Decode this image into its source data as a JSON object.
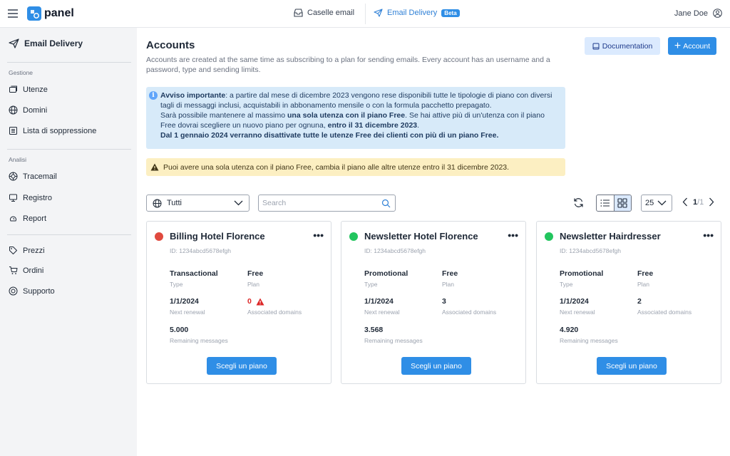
{
  "header": {
    "brand": "panel",
    "nav": [
      {
        "label": "Caselle email"
      },
      {
        "label": "Email Delivery",
        "badge": "Beta"
      }
    ],
    "user": "Jane Doe"
  },
  "sidebar": {
    "title": "Email Delivery",
    "sections": [
      {
        "heading": "Gestione",
        "items": [
          {
            "label": "Utenze",
            "icon": "users-icon"
          },
          {
            "label": "Domini",
            "icon": "globe-icon"
          },
          {
            "label": "Lista di soppressione",
            "icon": "list-icon"
          }
        ]
      },
      {
        "heading": "Analisi",
        "items": [
          {
            "label": "Tracemail",
            "icon": "trace-icon"
          },
          {
            "label": "Registro",
            "icon": "log-icon"
          },
          {
            "label": "Report",
            "icon": "report-icon"
          }
        ]
      },
      {
        "heading": "",
        "items": [
          {
            "label": "Prezzi",
            "icon": "tag-icon"
          },
          {
            "label": "Ordini",
            "icon": "cart-icon"
          },
          {
            "label": "Supporto",
            "icon": "support-icon"
          }
        ]
      }
    ]
  },
  "page": {
    "title": "Accounts",
    "description": "Accounts are created at the same time as subscribing to a plan for sending emails. Every account has an username and a password, type and sending limits.",
    "documentation_label": "Documentation",
    "account_label": "Account"
  },
  "info": {
    "p1_bold": "Avviso importante",
    "p1_rest": ": a partire dal mese di dicembre 2023 vengono rese disponibili tutte le tipologie di piano con diversi tagli di messaggi inclusi, acquistabili in abbonamento mensile o con la formula pacchetto prepagato.",
    "p2_start": "Sarà possibile mantenere al massimo ",
    "p2_bold": "una sola utenza con il piano Free",
    "p2_mid": ". Se hai attive più di un'utenza con il piano Free dovrai scegliere un nuovo piano per ognuna, ",
    "p2_bold2": "entro il 31 dicembre 2023",
    "p2_end": ".",
    "p3_bold": "Dal 1 gennaio 2024 verranno disattivate tutte le utenze Free dei clienti con più di un piano Free."
  },
  "warning": "Puoi avere una sola utenza con il piano Free, cambia il piano alle altre utenze entro il 31 dicembre 2023.",
  "toolbar": {
    "filter_value": "Tutti",
    "search_placeholder": "Search",
    "per_page": "25",
    "page_current": "1",
    "page_total": "/1"
  },
  "labels": {
    "type": "Type",
    "plan": "Plan",
    "next_renewal": "Next renewal",
    "associated_domains": "Associated domains",
    "remaining_messages": "Remaining messages",
    "choose_plan": "Scegli un piano"
  },
  "cards": [
    {
      "title": "Billing Hotel Florence",
      "id": "ID: 1234abcd5678efgh",
      "status_color": "#e04a3f",
      "type": "Transactional",
      "plan": "Free",
      "renewal": "1/1/2024",
      "domains": "0",
      "domains_warning": true,
      "remaining": "5.000"
    },
    {
      "title": "Newsletter Hotel Florence",
      "id": "ID: 1234abcd5678efgh",
      "status_color": "#22c55e",
      "type": "Promotional",
      "plan": "Free",
      "renewal": "1/1/2024",
      "domains": "3",
      "domains_warning": false,
      "remaining": "3.568"
    },
    {
      "title": "Newsletter Hairdresser",
      "id": "ID: 1234abcd5678efgh",
      "status_color": "#22c55e",
      "type": "Promotional",
      "plan": "Free",
      "renewal": "1/1/2024",
      "domains": "2",
      "domains_warning": false,
      "remaining": "4.920"
    }
  ],
  "colors": {
    "accent": "#2f8ee6",
    "info_bg": "#d7eaf9",
    "warning_bg": "#fcefc2",
    "danger": "#e04a3f",
    "success": "#22c55e"
  }
}
